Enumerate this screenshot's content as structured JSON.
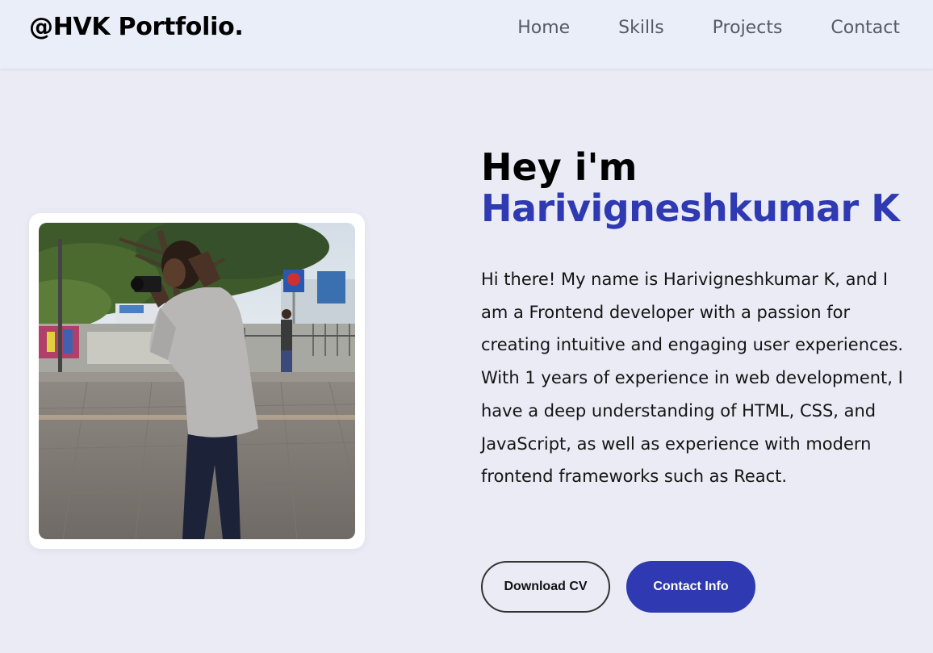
{
  "navbar": {
    "brand": "@HVK Portfolio.",
    "links": [
      "Home",
      "Skills",
      "Projects",
      "Contact"
    ]
  },
  "hero": {
    "greeting": "Hey i'm",
    "name": "Harivigneshkumar K",
    "bio": "Hi there! My name is Harivigneshkumar K, and I am a Frontend developer with a passion for creating intuitive and engaging user experiences. With 1 years of experience in web development, I have a deep understanding of HTML, CSS, and JavaScript, as well as experience with modern frontend frameworks such as React.",
    "buttons": {
      "download": "Download CV",
      "contact": "Contact Info"
    }
  },
  "colors": {
    "accent": "#2f3ab2",
    "background": "#ebebf6",
    "navbar": "#eaeef8"
  }
}
